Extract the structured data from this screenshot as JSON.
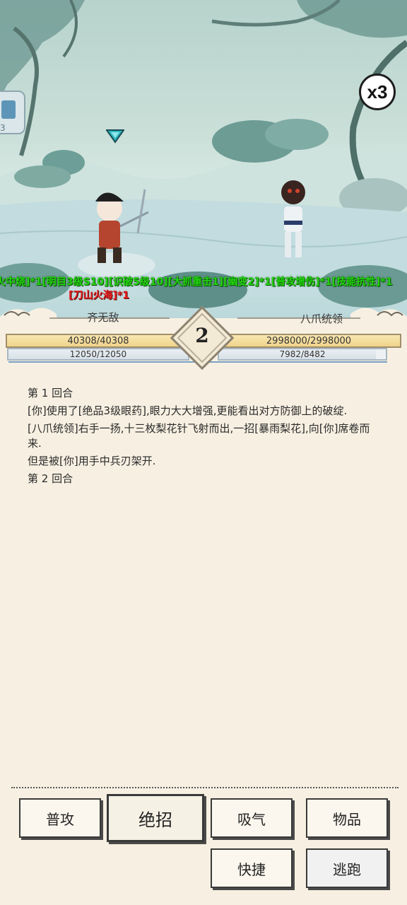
{
  "hud": {
    "speed": "x3",
    "side_icon_sub": "3"
  },
  "buffs": {
    "line1": "火中烧]*1[明目3级S10][识破5级10][大抓重击1][幽变2]*1[普攻增伤]*1[技能抗性]*1",
    "line2": "[刀山火海]*1"
  },
  "player": {
    "name": "齐无敌",
    "hp_text": "40308/40308",
    "hp_ratio": 1.0,
    "mp_text": "12050/12050",
    "mp_ratio": 1.0
  },
  "enemy": {
    "name": "八爪统领",
    "hp_text": "2998000/2998000",
    "hp_ratio": 1.0,
    "mp_text": "7982/8482",
    "mp_ratio": 0.94
  },
  "round": "2",
  "log": [
    "第 1 回合",
    "[你]使用了[绝品3级眼药],眼力大大增强,更能看出对方防御上的破绽.",
    "[八爪统领]右手一扬,十三枚梨花针飞射而出,一招[暴雨梨花],向[你]席卷而来.",
    "但是被[你]用手中兵刃架开.",
    "第 2 回合"
  ],
  "actions": {
    "attack": "普攻",
    "ultimate": "绝招",
    "breathe": "吸气",
    "items": "物品",
    "quick": "快捷",
    "flee": "逃跑"
  }
}
